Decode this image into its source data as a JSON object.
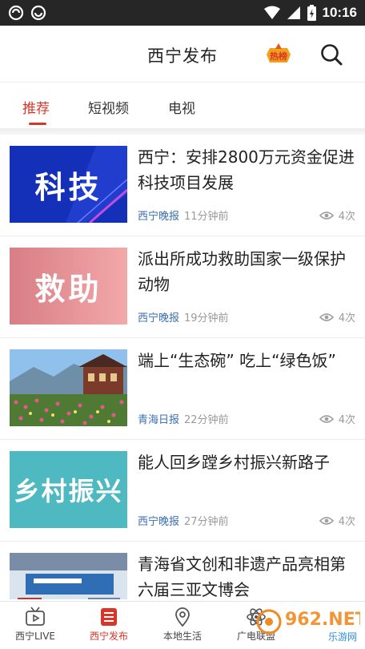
{
  "status_bar": {
    "time": "10:16"
  },
  "header": {
    "title": "西宁发布",
    "hot_badge_text": "热榜"
  },
  "tabs": [
    {
      "label": "推荐",
      "active": true
    },
    {
      "label": "短视频",
      "active": false
    },
    {
      "label": "电视",
      "active": false
    }
  ],
  "news": [
    {
      "title": "西宁：安排2800万元资金促进科技项目发展",
      "source": "西宁晚报",
      "time": "11分钟前",
      "views": "4次",
      "thumb_text": "科技",
      "thumb_style": "tech"
    },
    {
      "title": "派出所成功救助国家一级保护动物",
      "source": "西宁晚报",
      "time": "19分钟前",
      "views": "4次",
      "thumb_text": "救助",
      "thumb_style": "rescue"
    },
    {
      "title": "端上“生态碗” 吃上“绿色饭”",
      "source": "青海日报",
      "time": "22分钟前",
      "views": "4次",
      "thumb_text": "",
      "thumb_style": "photo-village"
    },
    {
      "title": "能人回乡蹚乡村振兴新路子",
      "source": "西宁晚报",
      "time": "27分钟前",
      "views": "4次",
      "thumb_text": "乡村振兴",
      "thumb_style": "rural"
    },
    {
      "title": "青海省文创和非遗产品亮相第六届三亚文博会",
      "source": "",
      "time": "",
      "views": "",
      "thumb_text": "",
      "thumb_style": "photo-expo"
    }
  ],
  "bottom_nav": [
    {
      "label": "西宁LIVE",
      "icon": "tv-icon",
      "active": false
    },
    {
      "label": "西宁发布",
      "icon": "list-icon",
      "active": true
    },
    {
      "label": "本地生活",
      "icon": "location-icon",
      "active": false
    },
    {
      "label": "广电联盟",
      "icon": "atom-icon",
      "active": false
    }
  ],
  "watermark": {
    "brand": "962.NET",
    "sub": "乐游网"
  },
  "colors": {
    "accent": "#d8362a",
    "source_blue": "#3a6fb0",
    "meta_gray": "#9a9a9a"
  }
}
